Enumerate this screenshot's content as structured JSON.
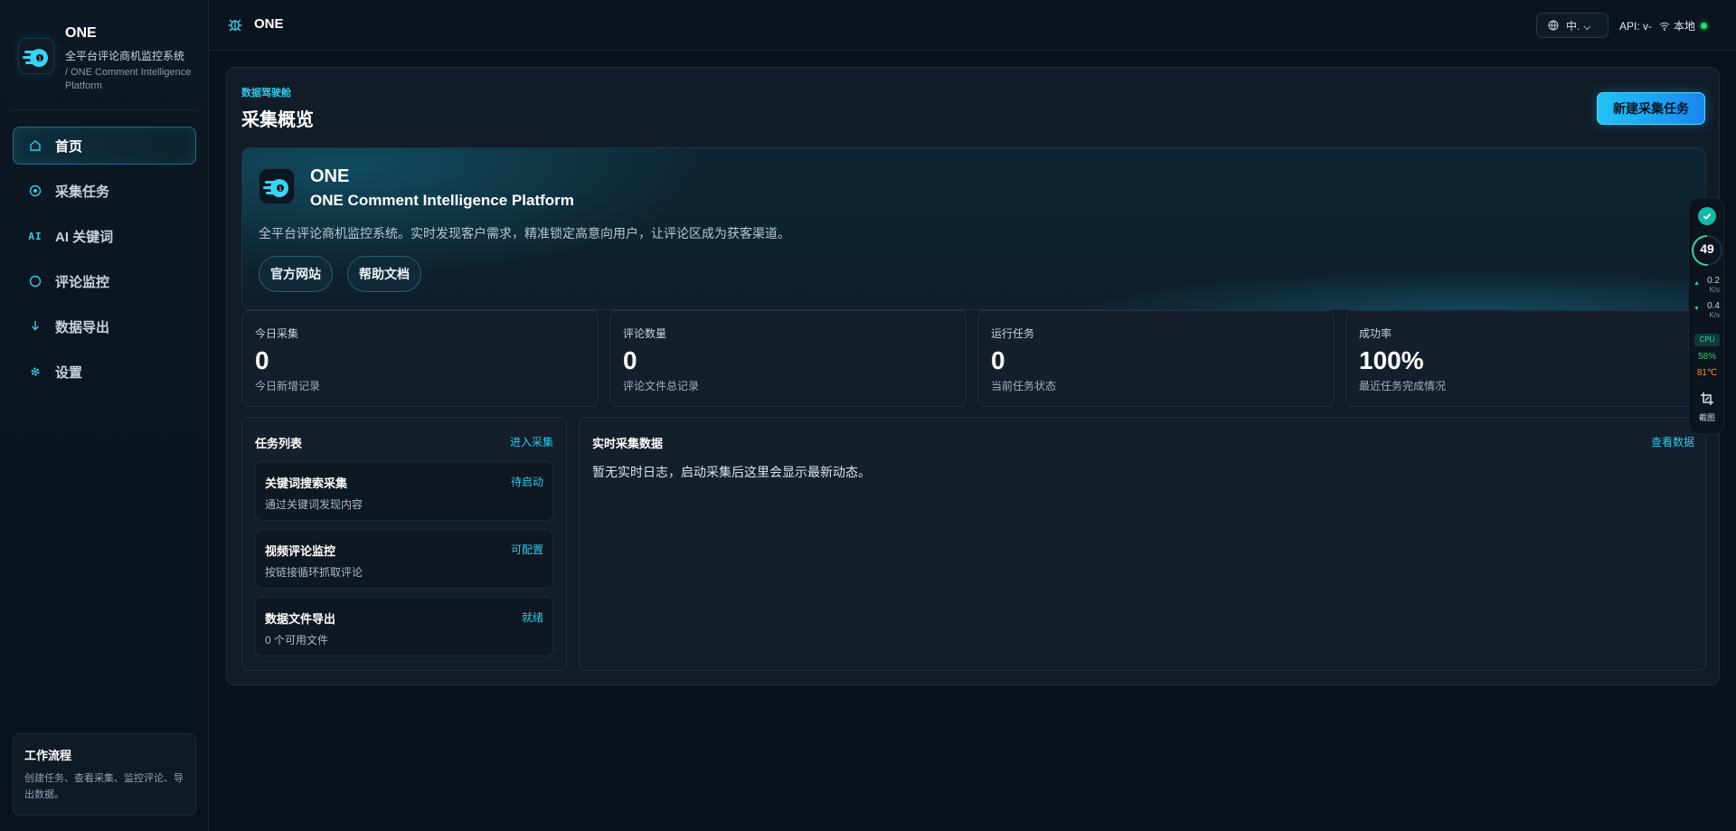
{
  "brand": {
    "name": "ONE",
    "subtitle": "全平台评论商机监控系统",
    "subtitle_en": "/ ONE Comment Intelligence Platform"
  },
  "sidebar": {
    "items": [
      {
        "label": "首页",
        "icon": "home-icon",
        "active": true
      },
      {
        "label": "采集任务",
        "icon": "target-icon",
        "active": false
      },
      {
        "label": "AI 关键词",
        "icon": "ai-icon",
        "active": false
      },
      {
        "label": "评论监控",
        "icon": "circle-icon",
        "active": false
      },
      {
        "label": "数据导出",
        "icon": "download-icon",
        "active": false
      },
      {
        "label": "设置",
        "icon": "gear-icon",
        "active": false
      }
    ],
    "workflow": {
      "title": "工作流程",
      "desc": "创建任务、查看采集、监控评论、导出数据。"
    }
  },
  "topbar": {
    "title": "ONE",
    "lang": "中.",
    "api_label": "API: v-",
    "network_label": "本地",
    "status_color": "#23e06b"
  },
  "header": {
    "eyebrow": "数据驾驶舱",
    "title": "采集概览",
    "new_task_label": "新建采集任务"
  },
  "hero": {
    "title": "ONE",
    "subtitle": "ONE Comment Intelligence Platform",
    "desc": "全平台评论商机监控系统。实时发现客户需求，精准锁定高意向用户，让评论区成为获客渠道。",
    "btn_site": "官方网站",
    "btn_docs": "帮助文档"
  },
  "stats": [
    {
      "label": "今日采集",
      "value": "0",
      "foot": "今日新增记录"
    },
    {
      "label": "评论数量",
      "value": "0",
      "foot": "评论文件总记录"
    },
    {
      "label": "运行任务",
      "value": "0",
      "foot": "当前任务状态"
    },
    {
      "label": "成功率",
      "value": "100%",
      "foot": "最近任务完成情况"
    }
  ],
  "tasks": {
    "title": "任务列表",
    "link": "进入采集",
    "items": [
      {
        "title": "关键词搜索采集",
        "status": "待启动",
        "desc": "通过关键词发现内容"
      },
      {
        "title": "视频评论监控",
        "status": "可配置",
        "desc": "按链接循环抓取评论"
      },
      {
        "title": "数据文件导出",
        "status": "就绪",
        "desc": "0 个可用文件"
      }
    ]
  },
  "live": {
    "title": "实时采集数据",
    "link": "查看数据",
    "empty": "暂无实时日志，启动采集后这里会显示最新动态。"
  },
  "monitor": {
    "score": "49",
    "score_fraction": 0.49,
    "up_rate": "0.2",
    "down_rate": "0.4",
    "rate_unit": "K/s",
    "cpu_label": "CPU",
    "cpu_pct": "58%",
    "cpu_temp": "81℃",
    "screenshot_label": "截图"
  },
  "colors": {
    "accent": "#2ec8ea",
    "button_start": "#21c3f3",
    "button_end": "#1a86f0"
  }
}
